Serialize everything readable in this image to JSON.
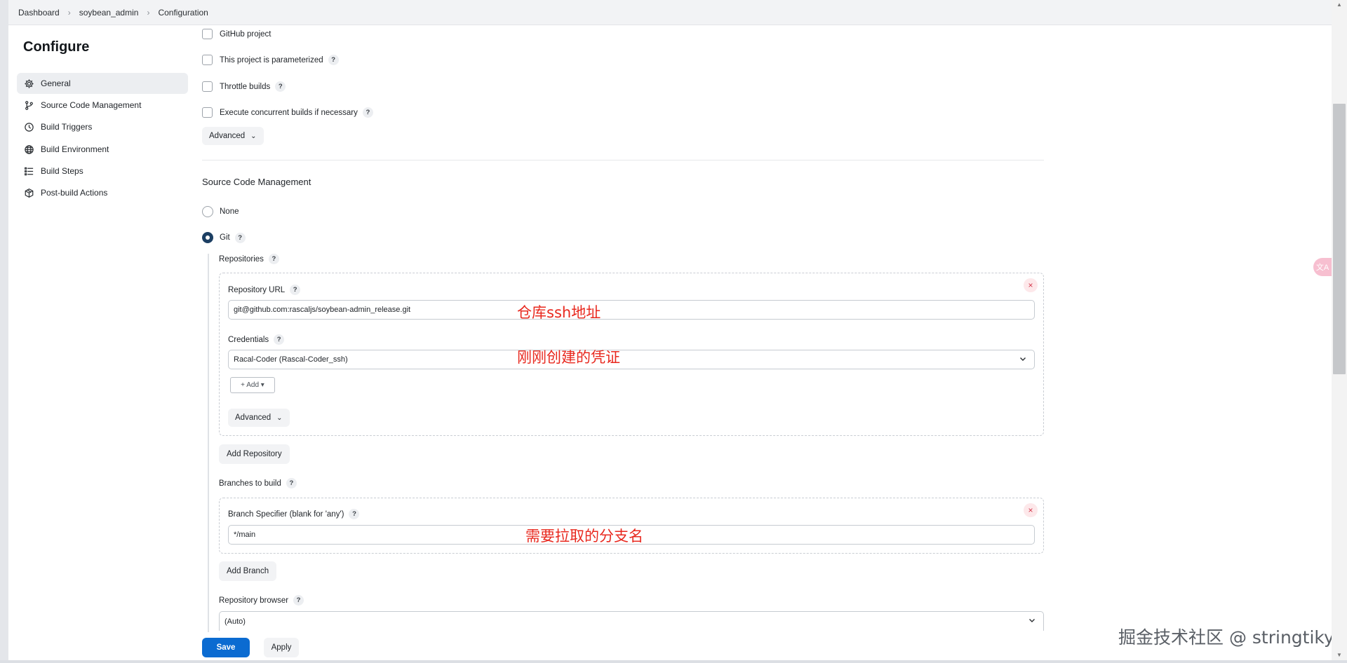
{
  "breadcrumb": [
    "Dashboard",
    "soybean_admin",
    "Configuration"
  ],
  "sidebar": {
    "title": "Configure",
    "items": [
      {
        "label": "General",
        "icon": "gear-icon"
      },
      {
        "label": "Source Code Management",
        "icon": "branch-icon"
      },
      {
        "label": "Build Triggers",
        "icon": "clock-icon"
      },
      {
        "label": "Build Environment",
        "icon": "globe-icon"
      },
      {
        "label": "Build Steps",
        "icon": "list-icon"
      },
      {
        "label": "Post-build Actions",
        "icon": "package-icon"
      }
    ]
  },
  "general": {
    "options": [
      {
        "label": "GitHub project",
        "checked": false,
        "help": false
      },
      {
        "label": "This project is parameterized",
        "checked": false,
        "help": true
      },
      {
        "label": "Throttle builds",
        "checked": false,
        "help": true
      },
      {
        "label": "Execute concurrent builds if necessary",
        "checked": false,
        "help": true
      }
    ],
    "advanced_label": "Advanced"
  },
  "help_symbol": "?",
  "scm": {
    "title": "Source Code Management",
    "none_label": "None",
    "git_label": "Git",
    "selected": "Git",
    "repositories_label": "Repositories",
    "repository_url_label": "Repository URL",
    "repository_url_value": "git@github.com:rascaljs/soybean-admin_release.git",
    "credentials_label": "Credentials",
    "credentials_value": "Racal-Coder (Rascal-Coder_ssh)",
    "add_label": "+ Add ▾",
    "advanced_label": "Advanced",
    "add_repository_label": "Add Repository",
    "branches_label": "Branches to build",
    "branch_specifier_label": "Branch Specifier (blank for 'any')",
    "branch_specifier_value": "*/main",
    "add_branch_label": "Add Branch",
    "repository_browser_label": "Repository browser",
    "repository_browser_value": "(Auto)",
    "close_symbol": "×"
  },
  "annotations": {
    "repo_url_note": "仓库ssh地址",
    "credentials_note": "刚刚创建的凭证",
    "branch_note": "需要拉取的分支名"
  },
  "footer": {
    "save_label": "Save",
    "apply_label": "Apply"
  },
  "watermark": "掘金技术社区 @ stringtiky",
  "float_pill_text": "文A",
  "colors": {
    "primary_button": "#0b6bd1",
    "radio_selected": "#1c3f63",
    "annotation": "#e8281e",
    "close_bg": "#fde8ea"
  }
}
